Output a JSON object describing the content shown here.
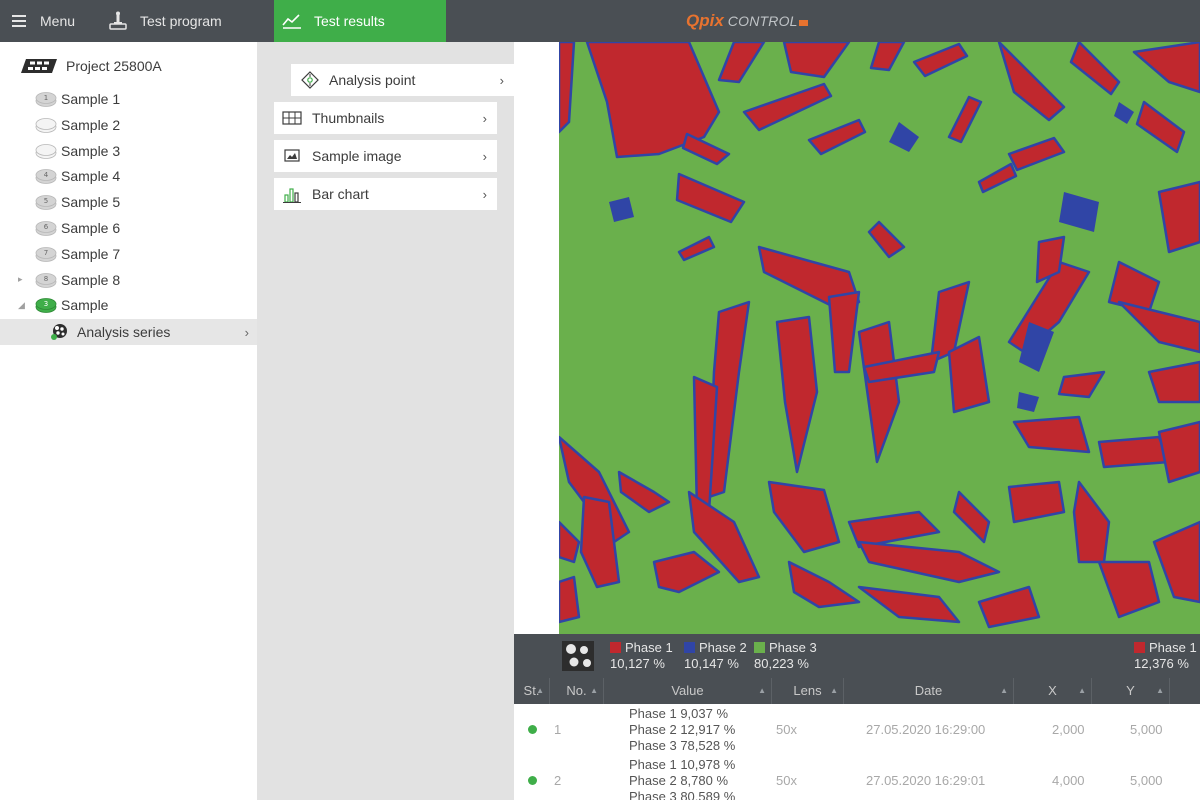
{
  "topbar": {
    "menu_label": "Menu",
    "test_program_label": "Test program",
    "test_results_label": "Test results",
    "brand_q": "Qpix",
    "brand_control": "CONTROL"
  },
  "tree": {
    "project": "Project 25800A",
    "samples": [
      {
        "badge": "1",
        "label": "Sample 1"
      },
      {
        "badge": "",
        "label": "Sample 2"
      },
      {
        "badge": "",
        "label": "Sample 3"
      },
      {
        "badge": "4",
        "label": "Sample 4"
      },
      {
        "badge": "5",
        "label": "Sample 5"
      },
      {
        "badge": "6",
        "label": "Sample 6"
      },
      {
        "badge": "7",
        "label": "Sample 7"
      },
      {
        "badge": "8",
        "label": "Sample 8"
      },
      {
        "badge": "3",
        "label": "Sample"
      }
    ],
    "analysis_series": "Analysis series"
  },
  "submenu": {
    "analysis_point": "Analysis point",
    "thumbnails": "Thumbnails",
    "sample_image": "Sample image",
    "bar_chart": "Bar chart"
  },
  "colors": {
    "phase1": "#c0282e",
    "phase2": "#3045a6",
    "phase3": "#6ab04c",
    "accent": "#3fae49",
    "topbar": "#4a4f54"
  },
  "legend": {
    "phases": [
      {
        "name": "Phase 1",
        "pct": "10,127 %"
      },
      {
        "name": "Phase 2",
        "pct": "10,147 %"
      },
      {
        "name": "Phase 3",
        "pct": "80,223 %"
      }
    ],
    "right": {
      "name": "Phase 1",
      "pct": "12,376 %"
    }
  },
  "table": {
    "headers": [
      "St.",
      "No.",
      "Value",
      "Lens",
      "Date",
      "X",
      "Y"
    ],
    "rows": [
      {
        "no": "1",
        "values": [
          "Phase 1 9,037 %",
          "Phase 2 12,917 %",
          "Phase 3 78,528 %"
        ],
        "lens": "50x",
        "date": "27.05.2020 16:29:00",
        "x": "2,000",
        "y": "5,000"
      },
      {
        "no": "2",
        "values": [
          "Phase 1 10,978 %",
          "Phase 2 8,780 %",
          "Phase 3 80,589 %"
        ],
        "lens": "50x",
        "date": "27.05.2020 16:29:01",
        "x": "4,000",
        "y": "5,000"
      }
    ]
  }
}
